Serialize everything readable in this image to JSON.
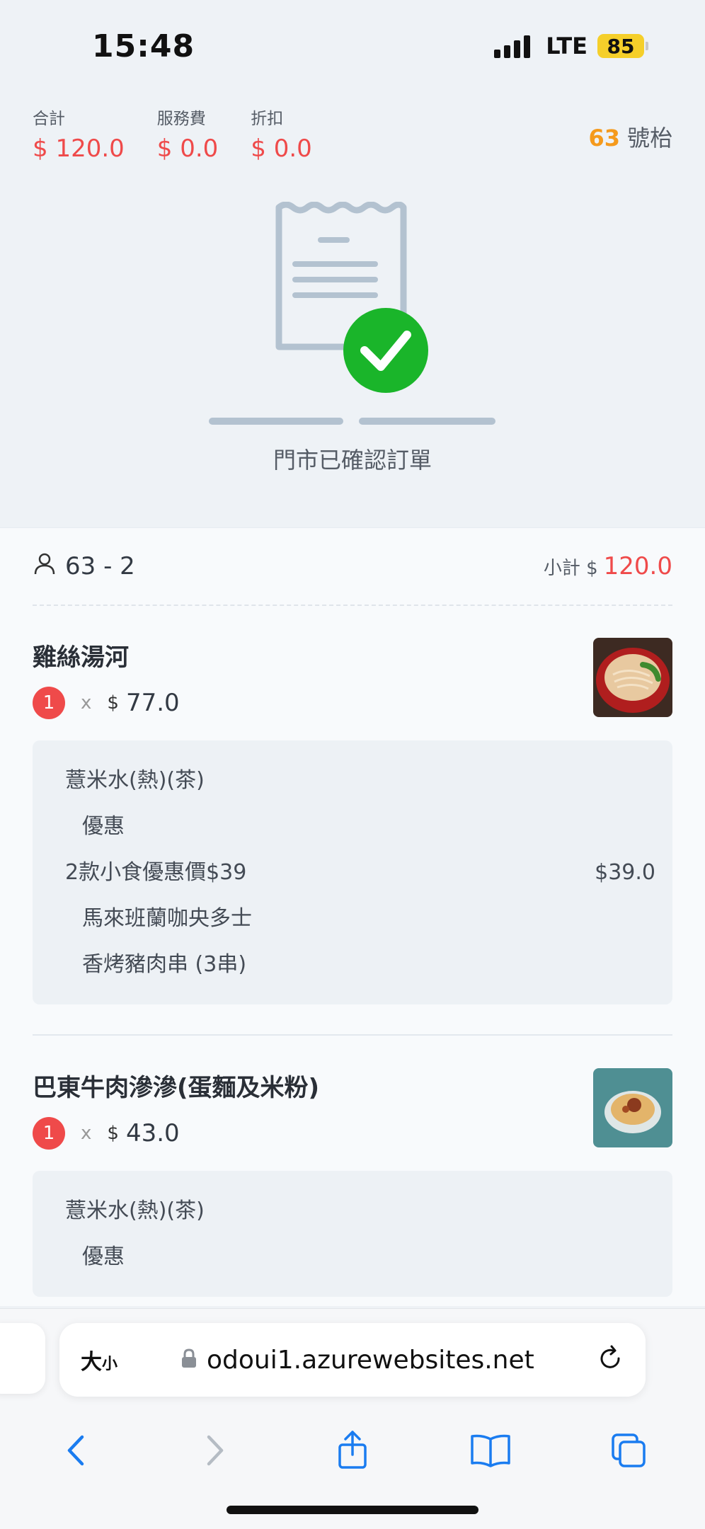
{
  "status_bar": {
    "time": "15:48",
    "network": "LTE",
    "battery": "85",
    "battery_color": "#f5cf2a"
  },
  "header": {
    "totals": [
      {
        "label": "合計",
        "value": "$ 120.0"
      },
      {
        "label": "服務費",
        "value": "$ 0.0"
      },
      {
        "label": "折扣",
        "value": "$ 0.0"
      }
    ],
    "table_number": "63",
    "table_suffix": "號枱"
  },
  "status_message": "門市已確認訂單",
  "order": {
    "guest": "63 - 2",
    "subtotal_label": "小計 $",
    "subtotal_value": "120.0",
    "items": [
      {
        "name": "雞絲湯河",
        "qty": "1",
        "times": "x",
        "price_symbol": "$",
        "price": "77.0",
        "options": [
          {
            "text": "薏米水(熱)(茶)",
            "price": ""
          },
          {
            "text": "優惠",
            "price": ""
          },
          {
            "text": "2款小食優惠價$39",
            "price": "$39.0"
          },
          {
            "text": "馬來班蘭咖央多士",
            "price": ""
          },
          {
            "text": "香烤豬肉串 (3串)",
            "price": ""
          }
        ]
      },
      {
        "name": "巴東牛肉滲滲(蛋麵及米粉)",
        "qty": "1",
        "times": "x",
        "price_symbol": "$",
        "price": "43.0",
        "options": [
          {
            "text": "薏米水(熱)(茶)",
            "price": ""
          },
          {
            "text": "優惠",
            "price": ""
          }
        ]
      }
    ]
  },
  "browser": {
    "text_size_big": "大",
    "text_size_small": "小",
    "url": "odoui1.azurewebsites.net"
  },
  "colors": {
    "accent_red": "#ef4a4a",
    "accent_orange": "#f59a1c",
    "ios_blue": "#1a7cf0",
    "check_green": "#1ab52a"
  }
}
